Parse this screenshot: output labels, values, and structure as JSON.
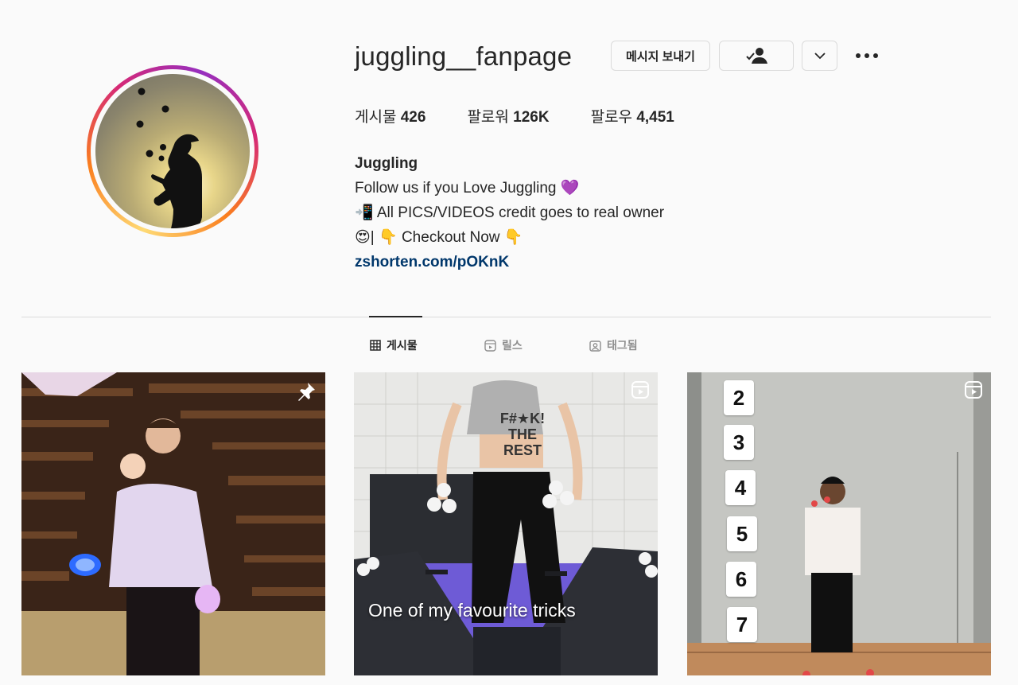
{
  "profile": {
    "username": "juggling__fanpage",
    "message_button": "메시지 보내기",
    "stats": {
      "posts_label": "게시물",
      "posts_value": "426",
      "followers_label": "팔로워",
      "followers_value": "126K",
      "following_label": "팔로우",
      "following_value": "4,451"
    },
    "bio": {
      "name": "Juggling",
      "line1": "Follow us if you Love Juggling 💜",
      "line2": "📲 All PICS/VIDEOS credit goes to real owner",
      "line3": "😍| 👇 Checkout Now 👇",
      "link": "zshorten.com/pOKnK"
    }
  },
  "tabs": [
    {
      "label": "게시물",
      "icon": "grid-icon",
      "active": true
    },
    {
      "label": "릴스",
      "icon": "reels-icon",
      "active": false
    },
    {
      "label": "태그됨",
      "icon": "tagged-icon",
      "active": false
    }
  ],
  "posts": [
    {
      "type": "pinned",
      "icon": "pin-icon"
    },
    {
      "type": "reel",
      "icon": "reels-icon",
      "caption": "One of my favourite tricks",
      "shirt_text": [
        "F#★K!",
        "THE",
        "REST"
      ]
    },
    {
      "type": "reel",
      "icon": "reels-icon",
      "numbers": [
        "2",
        "3",
        "4",
        "5",
        "6",
        "7"
      ]
    }
  ],
  "colors": {
    "text": "#262626",
    "muted": "#8e8e8e",
    "link": "#00376b",
    "border": "#dbdbdb",
    "background": "#fafafa"
  }
}
